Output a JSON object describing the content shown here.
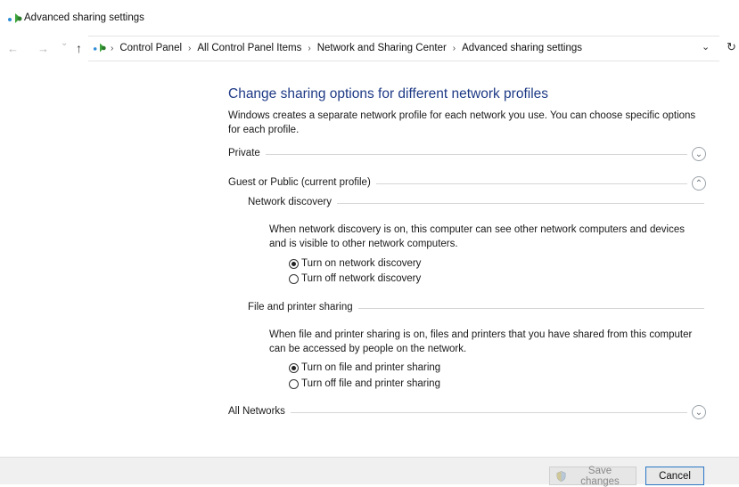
{
  "window": {
    "title": "Advanced sharing settings",
    "icon": "network-sharing-icon"
  },
  "navigation": {
    "back_icon": "arrow-left-icon",
    "forward_icon": "arrow-right-icon",
    "recent_icon": "chevron-down-icon",
    "up_icon": "arrow-up-icon",
    "back": "←",
    "forward": "→",
    "recent": "⌄",
    "up": "↑"
  },
  "address_bar": {
    "separator": "›",
    "breadcrumbs": [
      "Control Panel",
      "All Control Panel Items",
      "Network and Sharing Center",
      "Advanced sharing settings"
    ],
    "dropdown": "⌄",
    "refresh": "↻"
  },
  "content": {
    "heading": "Change sharing options for different network profiles",
    "intro": "Windows creates a separate network profile for each network you use. You can choose specific options for each profile.",
    "profiles": {
      "private": {
        "label": "Private",
        "state": "collapsed",
        "toggle": "⌄"
      },
      "guest_public": {
        "label": "Guest or Public (current profile)",
        "state": "expanded",
        "toggle": "⌃"
      },
      "all_networks": {
        "label": "All Networks",
        "state": "collapsed",
        "toggle": "⌄"
      }
    },
    "network_discovery": {
      "label": "Network discovery",
      "description": "When network discovery is on, this computer can see other network computers and devices and is visible to other network computers.",
      "options": [
        "Turn on network discovery",
        "Turn off network discovery"
      ],
      "selected": 0
    },
    "file_printer_sharing": {
      "label": "File and printer sharing",
      "description": "When file and printer sharing is on, files and printers that you have shared from this computer can be accessed by people on the network.",
      "options": [
        "Turn on file and printer sharing",
        "Turn off file and printer sharing"
      ],
      "selected": 0
    }
  },
  "footer": {
    "save_label": "Save changes",
    "save_enabled": false,
    "cancel_label": "Cancel"
  },
  "colors": {
    "heading": "#1e3a86",
    "accent": "#2a76c6"
  }
}
